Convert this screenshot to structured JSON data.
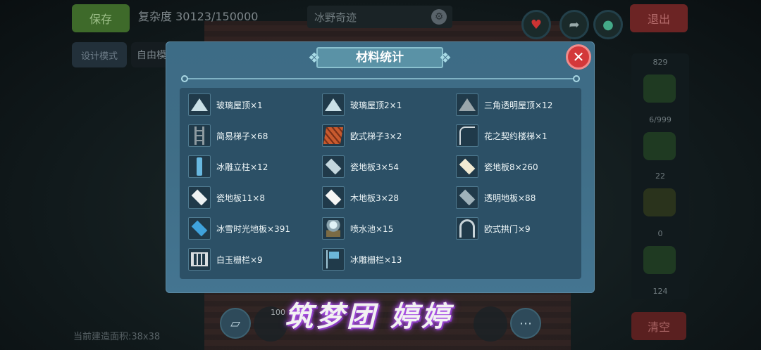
{
  "hud": {
    "save_label": "保存",
    "complexity_label": "复杂度 30123/150000",
    "scene_title": "冰野奇迹",
    "exit_label": "退出",
    "design_mode_label": "设计模式",
    "free_mode_label": "自由模",
    "build_area_label": "当前建造面积:38x38",
    "clear_label": "清空",
    "hotbar_count": "100",
    "right_panel_counts": [
      "829",
      "6/999",
      "22",
      "0",
      "124"
    ]
  },
  "dialog": {
    "title": "材料统计",
    "close_icon": "close-icon",
    "items": [
      {
        "icon": "glass-roof-icon",
        "label": "玻璃屋顶×1"
      },
      {
        "icon": "glass-roof-2-icon",
        "label": "玻璃屋顶2×1"
      },
      {
        "icon": "triangle-roof-icon",
        "label": "三角透明屋顶×12"
      },
      {
        "icon": "simple-ladder-icon",
        "label": "简易梯子×68"
      },
      {
        "icon": "euro-ladder-icon",
        "label": "欧式梯子3×2"
      },
      {
        "icon": "flower-stair-icon",
        "label": "花之契约楼梯×1"
      },
      {
        "icon": "ice-pillar-icon",
        "label": "冰雕立柱×12"
      },
      {
        "icon": "tile-floor-icon",
        "label": "瓷地板3×54"
      },
      {
        "icon": "tile-floor-8-icon",
        "label": "瓷地板8×260"
      },
      {
        "icon": "tile-floor-11-icon",
        "label": "瓷地板11×8"
      },
      {
        "icon": "wood-floor-icon",
        "label": "木地板3×28"
      },
      {
        "icon": "clear-floor-icon",
        "label": "透明地板×88"
      },
      {
        "icon": "ice-snow-floor-icon",
        "label": "冰雪时光地板×391"
      },
      {
        "icon": "fountain-icon",
        "label": "喷水池×15"
      },
      {
        "icon": "euro-arch-icon",
        "label": "欧式拱门×9"
      },
      {
        "icon": "jade-fence-icon",
        "label": "白玉栅栏×9"
      },
      {
        "icon": "ice-fence-icon",
        "label": "冰雕栅栏×13"
      }
    ]
  },
  "watermark": "筑梦团 婷婷",
  "colors": {
    "dialog_bg": "#3f6d86",
    "list_bg": "#2c5066",
    "close_red": "#d3383a",
    "watermark_glow": "#b55df0"
  }
}
